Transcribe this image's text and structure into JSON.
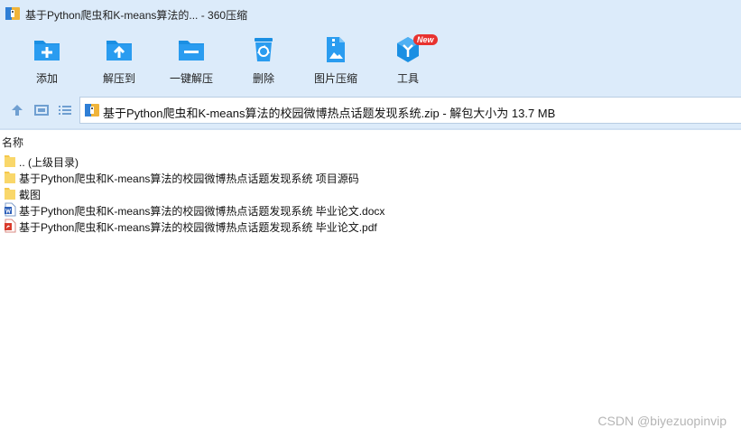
{
  "window": {
    "title": "基于Python爬虫和K-means算法的... - 360压缩"
  },
  "toolbar": {
    "add": "添加",
    "extract_to": "解压到",
    "one_click_extract": "一键解压",
    "delete": "删除",
    "image_compress": "图片压缩",
    "tools": "工具",
    "tools_badge": "New"
  },
  "address": {
    "path": "基于Python爬虫和K-means算法的校园微博热点话题发现系统.zip - 解包大小为 13.7 MB"
  },
  "list": {
    "column_name": "名称",
    "items": [
      {
        "name": ".. (上级目录)"
      },
      {
        "name": "基于Python爬虫和K-means算法的校园微博热点话题发现系统 项目源码"
      },
      {
        "name": "截图"
      },
      {
        "name": "基于Python爬虫和K-means算法的校园微博热点话题发现系统 毕业论文.docx"
      },
      {
        "name": "基于Python爬虫和K-means算法的校园微博热点话题发现系统 毕业论文.pdf"
      }
    ]
  },
  "watermark": "CSDN @biyezuopinvip",
  "colors": {
    "chrome_bg": "#dcebfa",
    "icon_blue": "#1a8fe3",
    "folder_yellow": "#f5c84c",
    "word_blue": "#2b5eb8",
    "pdf_red": "#d93a2b",
    "badge_red": "#e8322f"
  }
}
